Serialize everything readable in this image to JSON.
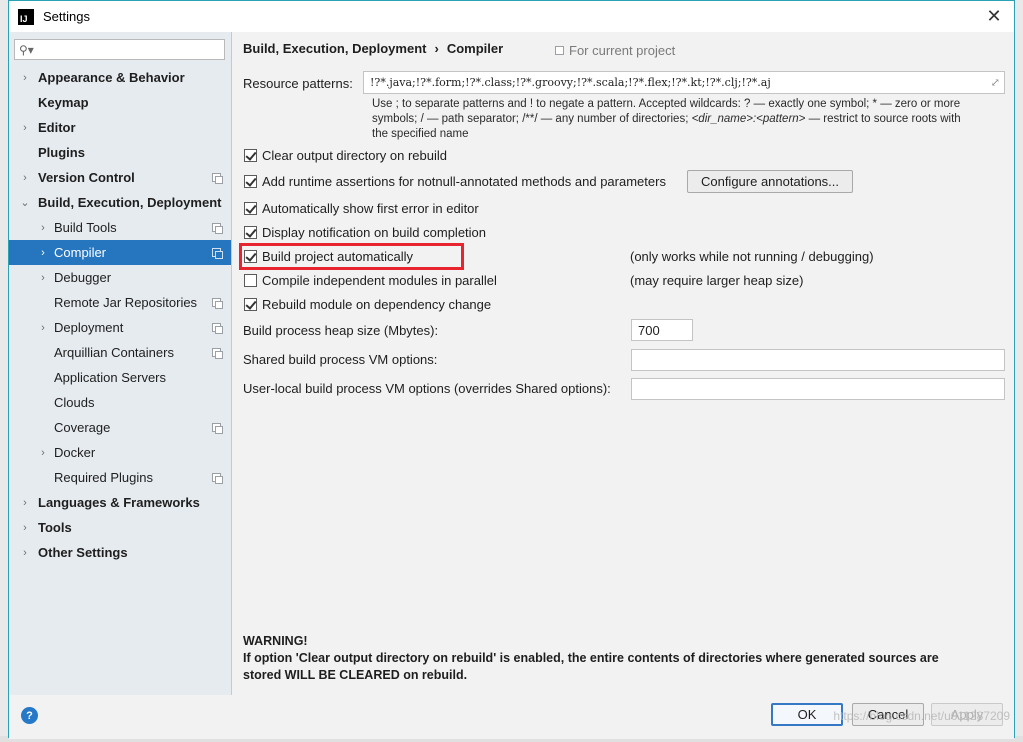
{
  "window": {
    "title": "Settings",
    "app_icon_text": "IJ",
    "close_glyph": "✕"
  },
  "sidebar": {
    "search_value": "",
    "items": [
      {
        "label": "Appearance & Behavior",
        "bold": true,
        "expandable": true,
        "indent": 0,
        "project": false
      },
      {
        "label": "Keymap",
        "bold": true,
        "expandable": false,
        "indent": 0,
        "project": false
      },
      {
        "label": "Editor",
        "bold": true,
        "expandable": true,
        "indent": 0,
        "project": false
      },
      {
        "label": "Plugins",
        "bold": true,
        "expandable": false,
        "indent": 0,
        "project": false
      },
      {
        "label": "Version Control",
        "bold": true,
        "expandable": true,
        "indent": 0,
        "project": true
      },
      {
        "label": "Build, Execution, Deployment",
        "bold": true,
        "expandable": true,
        "expanded": true,
        "indent": 0,
        "project": false
      },
      {
        "label": "Build Tools",
        "bold": false,
        "expandable": true,
        "indent": 1,
        "project": true
      },
      {
        "label": "Compiler",
        "bold": false,
        "expandable": true,
        "indent": 1,
        "project": true,
        "selected": true
      },
      {
        "label": "Debugger",
        "bold": false,
        "expandable": true,
        "indent": 1,
        "project": false
      },
      {
        "label": "Remote Jar Repositories",
        "bold": false,
        "expandable": false,
        "indent": 1,
        "project": true
      },
      {
        "label": "Deployment",
        "bold": false,
        "expandable": true,
        "indent": 1,
        "project": true
      },
      {
        "label": "Arquillian Containers",
        "bold": false,
        "expandable": false,
        "indent": 1,
        "project": true
      },
      {
        "label": "Application Servers",
        "bold": false,
        "expandable": false,
        "indent": 1,
        "project": false
      },
      {
        "label": "Clouds",
        "bold": false,
        "expandable": false,
        "indent": 1,
        "project": false
      },
      {
        "label": "Coverage",
        "bold": false,
        "expandable": false,
        "indent": 1,
        "project": true
      },
      {
        "label": "Docker",
        "bold": false,
        "expandable": true,
        "indent": 1,
        "project": false
      },
      {
        "label": "Required Plugins",
        "bold": false,
        "expandable": false,
        "indent": 1,
        "project": true
      },
      {
        "label": "Languages & Frameworks",
        "bold": true,
        "expandable": true,
        "indent": 0,
        "project": false
      },
      {
        "label": "Tools",
        "bold": true,
        "expandable": true,
        "indent": 0,
        "project": false
      },
      {
        "label": "Other Settings",
        "bold": true,
        "expandable": true,
        "indent": 0,
        "project": false
      }
    ]
  },
  "main": {
    "breadcrumb": {
      "parent": "Build, Execution, Deployment",
      "separator": "›",
      "current": "Compiler"
    },
    "for_current_project": "For current project",
    "resource_patterns": {
      "label": "Resource patterns:",
      "value": "!?*.java;!?*.form;!?*.class;!?*.groovy;!?*.scala;!?*.flex;!?*.kt;!?*.clj;!?*.aj",
      "hint_line1": "Use ; to separate patterns and ! to negate a pattern. Accepted wildcards: ? — exactly one symbol; * — zero or more",
      "hint_line2": "symbols; / — path separator; /**/ — any number of directories;",
      "hint_line2_italic": "<dir_name>:<pattern>",
      "hint_line2_tail": " — restrict to source roots with",
      "hint_line3": "the specified name"
    },
    "options": {
      "clear_output": {
        "label": "Clear output directory on rebuild",
        "checked": true
      },
      "runtime_assertions": {
        "label": "Add runtime assertions for notnull-annotated methods and parameters",
        "checked": true
      },
      "configure_annotations": "Configure annotations...",
      "show_first_error": {
        "label": "Automatically show first error in editor",
        "checked": true
      },
      "display_notification": {
        "label": "Display notification on build completion",
        "checked": true
      },
      "build_automatically": {
        "label": "Build project automatically",
        "checked": true,
        "note": "(only works while not running / debugging)"
      },
      "compile_parallel": {
        "label": "Compile independent modules in parallel",
        "checked": false,
        "note": "(may require larger heap size)"
      },
      "rebuild_module": {
        "label": "Rebuild module on dependency change",
        "checked": true
      }
    },
    "heap_size": {
      "label": "Build process heap size (Mbytes):",
      "value": "700"
    },
    "shared_vm": {
      "label": "Shared build process VM options:",
      "value": ""
    },
    "user_vm": {
      "label": "User-local build process VM options (overrides Shared options):",
      "value": ""
    },
    "warning": {
      "title": "WARNING!",
      "line1": "If option 'Clear output directory on rebuild' is enabled, the entire contents of directories where generated sources are",
      "line2": "stored WILL BE CLEARED on rebuild."
    }
  },
  "footer": {
    "help": "?",
    "ok": "OK",
    "cancel": "Cancel",
    "apply": "Apply",
    "watermark": "https://blog.csdn.net/u011287209"
  },
  "colors": {
    "selection": "#2675bf",
    "highlight_box": "#e8252e",
    "titlebar_border": "#2aa2b6"
  }
}
